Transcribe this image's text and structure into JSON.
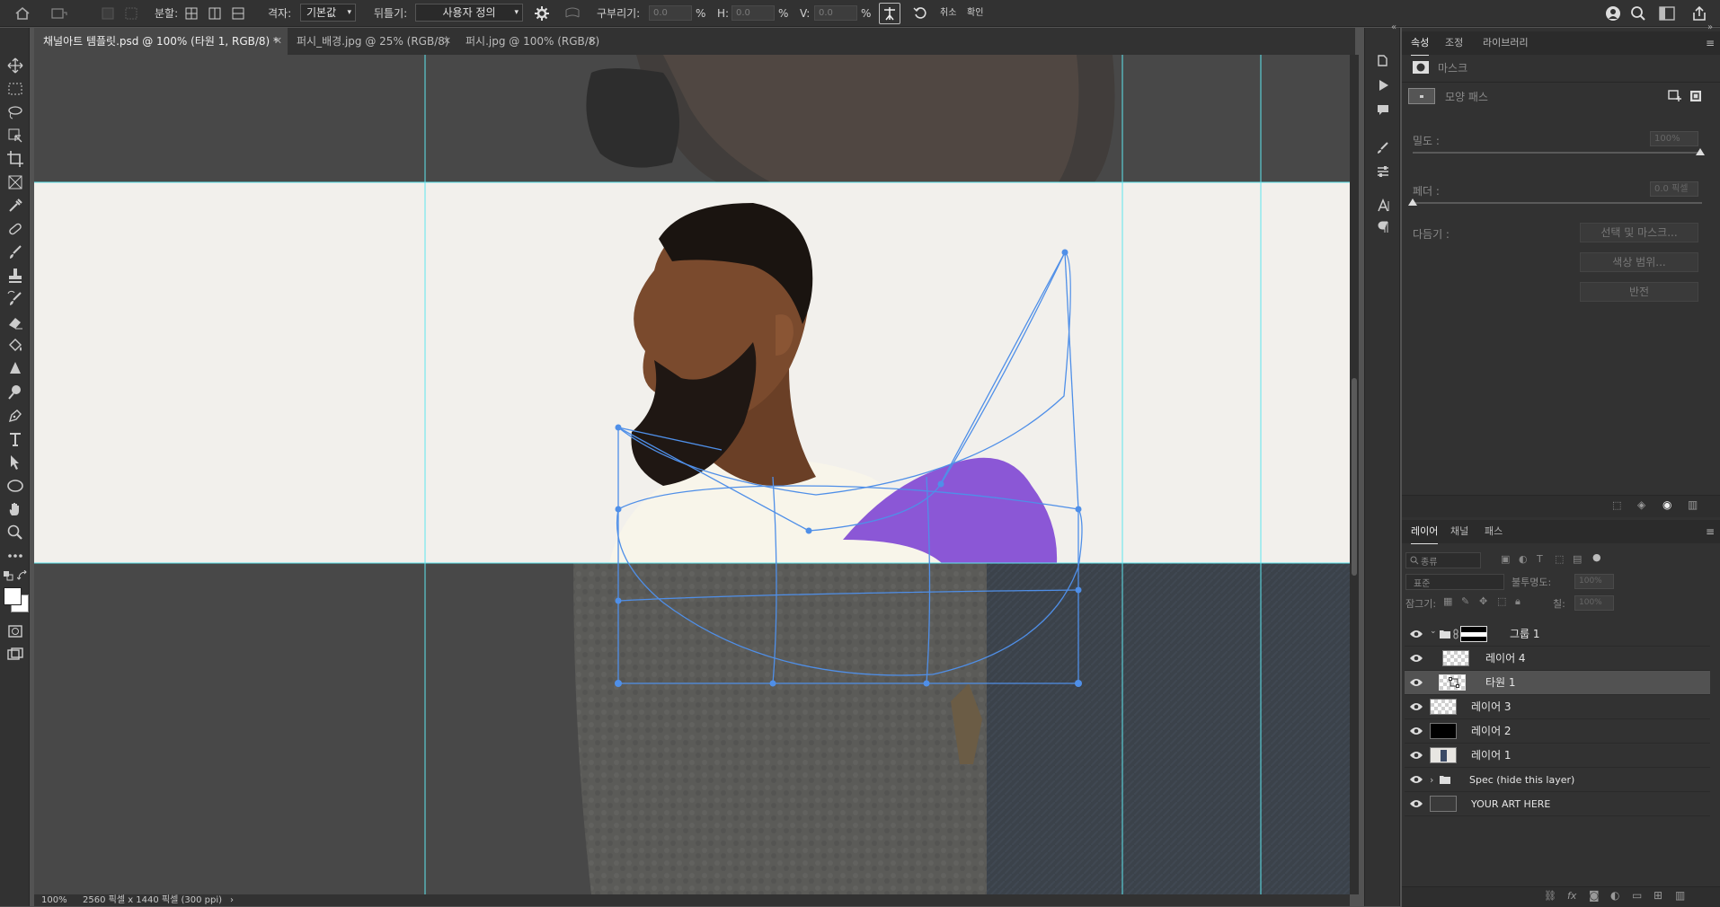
{
  "options_bar": {
    "split_label": "분할:",
    "grid_label": "격자:",
    "grid_value": "기본값",
    "warp_label": "뒤틀기:",
    "warp_value": "사용자 정의",
    "curvature_label": "구부리기:",
    "curvature_value": "0.0",
    "h_label": "H:",
    "h_value": "0.0",
    "v_label": "V:",
    "v_value": "0.0",
    "percent": "%",
    "cancel_label": "취소",
    "confirm_label": "확인"
  },
  "doc_tabs": [
    {
      "label": "채널아트 템플릿.psd @ 100% (타원 1, RGB/8) *",
      "active": true
    },
    {
      "label": "퍼시_배경.jpg @ 25% (RGB/8)",
      "active": false
    },
    {
      "label": "퍼시.jpg @ 100% (RGB/8)",
      "active": false
    }
  ],
  "status": {
    "zoom": "100%",
    "doc_info": "2560 픽셀 x 1440 픽셀 (300 ppi)",
    "arrow": "›"
  },
  "properties_panel": {
    "tabs": [
      "속성",
      "조정",
      "라이브러리"
    ],
    "active_tab": "속성",
    "mask_label": "마스크",
    "shape_path_label": "모양 패스",
    "density_label": "밀도 :",
    "density_value": "100%",
    "feather_label": "페더 :",
    "feather_value": "0.0 픽셀",
    "refine_label": "다듬기 :",
    "select_mask_button": "선택 및 마스크...",
    "color_range_button": "색상 범위...",
    "invert_button": "반전"
  },
  "layers_panel": {
    "tabs": [
      "레이어",
      "채널",
      "패스"
    ],
    "active_tab": "레이어",
    "filter_label": "종류",
    "blend_mode": "표준",
    "opacity_label": "불투명도:",
    "opacity_value": "100%",
    "lock_label": "잠그기:",
    "fill_label": "칠:",
    "fill_value": "100%",
    "layers": [
      {
        "name": "그룹 1",
        "kind": "group-open",
        "thumb": "black-white"
      },
      {
        "name": "레이어 4",
        "kind": "child",
        "thumb": "checker"
      },
      {
        "name": "타원 1",
        "kind": "child-selected",
        "thumb": "shape"
      },
      {
        "name": "레이어 3",
        "kind": "layer",
        "thumb": "checker"
      },
      {
        "name": "레이어 2",
        "kind": "layer",
        "thumb": "black"
      },
      {
        "name": "레이어 1",
        "kind": "layer",
        "thumb": "photo"
      },
      {
        "name": "Spec (hide this layer)",
        "kind": "group-closed",
        "thumb": "folder"
      },
      {
        "name": "YOUR ART HERE",
        "kind": "layer",
        "thumb": "dark"
      }
    ]
  },
  "colors": {
    "accent_purple": "#8b57d6",
    "guide_cyan": "#5ee6ee",
    "warp_blue": "#4f8fe8",
    "banner_bg": "#f2f0ec"
  },
  "icons": [
    "home-icon",
    "move-icon",
    "marquee-icon",
    "lasso-icon",
    "object-select-icon",
    "crop-icon",
    "frame-icon",
    "eyedropper-icon",
    "healing-icon",
    "brush-icon",
    "stamp-icon",
    "history-brush-icon",
    "eraser-icon",
    "bucket-icon",
    "blur-icon",
    "dodge-icon",
    "pen-icon",
    "type-icon",
    "path-select-icon",
    "ellipse-icon",
    "hand-icon",
    "zoom-icon",
    "more-icon",
    "gear-icon",
    "reset-icon",
    "search-icon",
    "share-icon",
    "eye-icon",
    "folder-icon",
    "chain-icon",
    "lock-icon"
  ]
}
